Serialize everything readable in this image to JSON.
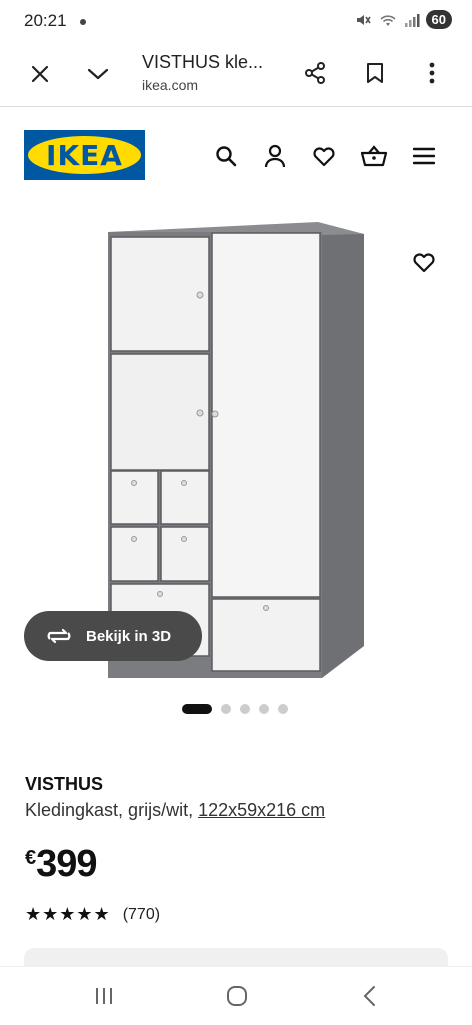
{
  "status_bar": {
    "time": "20:21",
    "battery": "60"
  },
  "browser": {
    "title": "VISTHUS kle...",
    "url": "ikea.com"
  },
  "header": {
    "logo_text": "IKEA"
  },
  "colors": {
    "ikea_blue": "#0058a3",
    "ikea_yellow": "#ffdb00",
    "view3d_bg": "#4a4a4a"
  },
  "icons": {
    "close": "close-icon",
    "chevron": "chevron-down-icon",
    "share": "share-icon",
    "bookmark": "bookmark-icon",
    "menu": "more-vert-icon",
    "search": "search-icon",
    "profile": "profile-icon",
    "favorite": "heart-icon",
    "basket": "basket-icon",
    "hamburger": "hamburger-menu-icon"
  },
  "gallery": {
    "view3d_label": "Bekijk in 3D",
    "total_images": 5,
    "active_index": 0
  },
  "product": {
    "name": "VISTHUS",
    "description": "Kledingkast, grijs/wit, ",
    "dimensions": "122x59x216 cm",
    "currency": "€",
    "price": "399",
    "rating_count": "(770)",
    "rating_stars": 5
  }
}
